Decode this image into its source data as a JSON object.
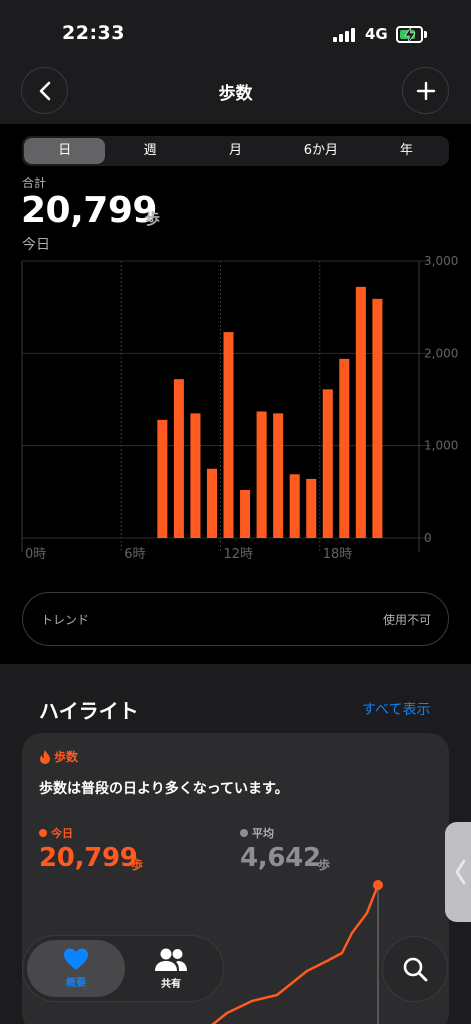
{
  "status_bar": {
    "time": "22:33",
    "network": "4G",
    "battery_level": 0.8
  },
  "header": {
    "title": "歩数",
    "back_icon": "chevron-left-icon",
    "add_icon": "plus-icon"
  },
  "segments": {
    "items": [
      "日",
      "週",
      "月",
      "6か月",
      "年"
    ],
    "selected": "日"
  },
  "summary": {
    "label": "合計",
    "value": "20,799",
    "unit": "歩",
    "date": "今日"
  },
  "chart_data": {
    "type": "bar",
    "x_tick_labels": [
      "0時",
      "6時",
      "12時",
      "18時"
    ],
    "y_tick_labels": [
      "3,000",
      "2,000",
      "1,000",
      "0"
    ],
    "ylim": [
      0,
      3000
    ],
    "grid": true,
    "bar_color": "#ff5a1f",
    "x": [
      8,
      9,
      10,
      11,
      12,
      13,
      14,
      15,
      16,
      17,
      18,
      19,
      20,
      21
    ],
    "values": [
      1280,
      1720,
      1350,
      750,
      2230,
      520,
      1370,
      1350,
      690,
      640,
      1610,
      1940,
      2720,
      2590
    ]
  },
  "trend": {
    "label": "トレンド",
    "value": "使用不可"
  },
  "highlights": {
    "title": "ハイライト",
    "show_all": "すべて表示",
    "card": {
      "category": "歩数",
      "category_icon": "flame-icon",
      "message": "歩数は普段の日より多くなっています。",
      "today_label": "今日",
      "today_value": "20,799",
      "today_unit": "歩",
      "avg_label": "平均",
      "avg_value": "4,642",
      "avg_unit": "歩",
      "accent": "#ff5a1f"
    }
  },
  "tabbar": {
    "items": [
      {
        "label": "概要",
        "icon": "heart-icon",
        "active": true
      },
      {
        "label": "共有",
        "icon": "people-icon",
        "active": false
      }
    ]
  },
  "search_icon": "search-icon",
  "side_handle_icon": "chevron-left-icon"
}
